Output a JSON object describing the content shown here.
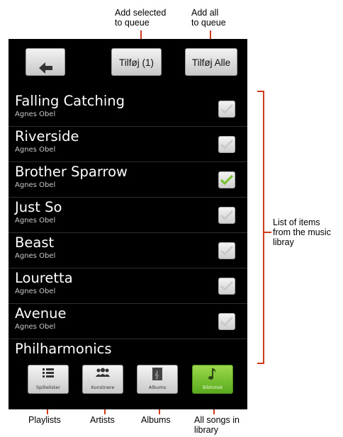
{
  "annotations": {
    "add_selected": [
      "Add selected",
      "to queue"
    ],
    "add_all": [
      "Add all",
      "to queue"
    ],
    "list_items": [
      "List of items",
      "from the music",
      "libray"
    ],
    "playlists": "Playlists",
    "artists": "Artists",
    "albums": "Albums",
    "all_songs": [
      "All songs in",
      "library"
    ]
  },
  "toolbar": {
    "back_icon": "arrow-left-icon",
    "add_selected_label": "Tilføj (1)",
    "add_all_label": "Tilføj Alle"
  },
  "songs": [
    {
      "title": "Falling Catching",
      "artist": "Agnes Obel",
      "checked": false
    },
    {
      "title": "Riverside",
      "artist": "Agnes Obel",
      "checked": false
    },
    {
      "title": "Brother Sparrow",
      "artist": "Agnes Obel",
      "checked": true
    },
    {
      "title": "Just So",
      "artist": "Agnes Obel",
      "checked": false
    },
    {
      "title": "Beast",
      "artist": "Agnes Obel",
      "checked": false
    },
    {
      "title": "Louretta",
      "artist": "Agnes Obel",
      "checked": false
    },
    {
      "title": "Avenue",
      "artist": "Agnes Obel",
      "checked": false
    },
    {
      "title": "Philharmonics",
      "artist": "",
      "checked": false
    }
  ],
  "nav": [
    {
      "label": "Spillelister",
      "icon": "list-icon",
      "active": false
    },
    {
      "label": "Kunstnere",
      "icon": "people-icon",
      "active": false
    },
    {
      "label": "Albums",
      "icon": "album-icon",
      "active": false
    },
    {
      "label": "Bibliotek",
      "icon": "music-note-icon",
      "active": true
    }
  ],
  "colors": {
    "accent": "#d23a1c",
    "active_green": "#7cc334"
  }
}
